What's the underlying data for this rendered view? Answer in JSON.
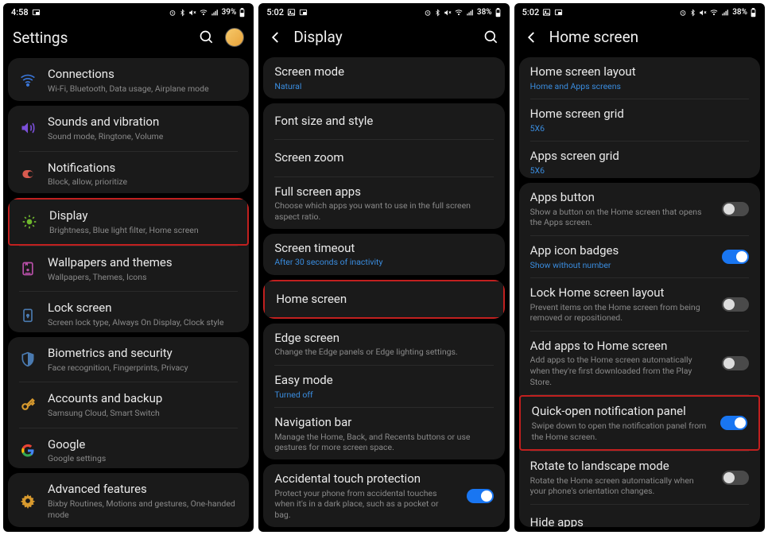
{
  "screen1": {
    "status": {
      "time": "4:58",
      "battery": "39%"
    },
    "header": {
      "title": "Settings"
    },
    "groups": [
      [
        {
          "icon": "wifi",
          "color": "#3a76d8",
          "title": "Connections",
          "sub": "Wi-Fi, Bluetooth, Data usage, Airplane mode"
        }
      ],
      [
        {
          "icon": "sound",
          "color": "#7a4fd8",
          "title": "Sounds and vibration",
          "sub": "Sound mode, Ringtone, Volume"
        },
        {
          "icon": "notif",
          "color": "#d85a4f",
          "title": "Notifications",
          "sub": "Block, allow, prioritize"
        }
      ],
      [
        {
          "icon": "display",
          "color": "#6fb82e",
          "title": "Display",
          "sub": "Brightness, Blue light filter, Home screen",
          "highlight": true
        },
        {
          "icon": "wallpaper",
          "color": "#b84fa8",
          "title": "Wallpapers and themes",
          "sub": "Wallpapers, Themes, Icons"
        },
        {
          "icon": "lock",
          "color": "#4a7ab0",
          "title": "Lock screen",
          "sub": "Screen lock type, Always On Display, Clock style"
        }
      ],
      [
        {
          "icon": "shield",
          "color": "#4a7ab0",
          "title": "Biometrics and security",
          "sub": "Face recognition, Fingerprints, Privacy"
        },
        {
          "icon": "key",
          "color": "#d89a2e",
          "title": "Accounts and backup",
          "sub": "Samsung Cloud, Smart Switch"
        },
        {
          "icon": "google",
          "color": "#3a76d8",
          "title": "Google",
          "sub": "Google settings"
        }
      ],
      [
        {
          "icon": "gear",
          "color": "#d89a2e",
          "title": "Advanced features",
          "sub": "Bixby Routines, Motions and gestures, One-handed mode"
        }
      ]
    ]
  },
  "screen2": {
    "status": {
      "time": "5:02",
      "battery": "38%"
    },
    "header": {
      "title": "Display"
    },
    "groups": [
      [
        {
          "title": "Screen mode",
          "sub": "Natural",
          "subBlue": true
        }
      ],
      [
        {
          "title": "Font size and style"
        },
        {
          "title": "Screen zoom"
        },
        {
          "title": "Full screen apps",
          "sub": "Choose which apps you want to use in the full screen aspect ratio."
        }
      ],
      [
        {
          "title": "Screen timeout",
          "sub": "After 30 seconds of inactivity",
          "subBlue": true
        }
      ],
      [
        {
          "title": "Home screen",
          "highlight": true
        }
      ],
      [
        {
          "title": "Edge screen",
          "sub": "Change the Edge panels or Edge lighting settings."
        },
        {
          "title": "Easy mode",
          "sub": "Turned off",
          "subBlue": true
        },
        {
          "title": "Navigation bar",
          "sub": "Manage the Home, Back, and Recents buttons or use gestures for more screen space."
        }
      ],
      [
        {
          "title": "Accidental touch protection",
          "sub": "Protect your phone from accidental touches when it's in a dark place, such as a pocket or bag.",
          "toggle": true,
          "on": true
        }
      ]
    ]
  },
  "screen3": {
    "status": {
      "time": "5:02",
      "battery": "38%"
    },
    "header": {
      "title": "Home screen"
    },
    "groups": [
      [
        {
          "title": "Home screen layout",
          "sub": "Home and Apps screens",
          "subBlue": true
        },
        {
          "title": "Home screen grid",
          "sub": "5X6",
          "subBlue": true
        },
        {
          "title": "Apps screen grid",
          "sub": "5X6",
          "subBlue": true
        }
      ],
      [
        {
          "title": "Apps button",
          "sub": "Show a button on the Home screen that opens the Apps screen.",
          "toggle": true,
          "on": false
        },
        {
          "title": "App icon badges",
          "sub": "Show without number",
          "subBlue": true,
          "toggle": true,
          "on": true
        },
        {
          "title": "Lock Home screen layout",
          "sub": "Prevent items on the Home screen from being removed or repositioned.",
          "toggle": true,
          "on": false
        },
        {
          "title": "Add apps to Home screen",
          "sub": "Add apps to the Home screen automatically when they're first downloaded from the Play Store.",
          "toggle": true,
          "on": false
        },
        {
          "title": "Quick-open notification panel",
          "sub": "Swipe down to open the notification panel from the Home screen.",
          "toggle": true,
          "on": true,
          "highlight": true
        },
        {
          "title": "Rotate to landscape mode",
          "sub": "Rotate the Home screen automatically when your phone's orientation changes.",
          "toggle": true,
          "on": false
        },
        {
          "title": "Hide apps"
        }
      ]
    ]
  }
}
